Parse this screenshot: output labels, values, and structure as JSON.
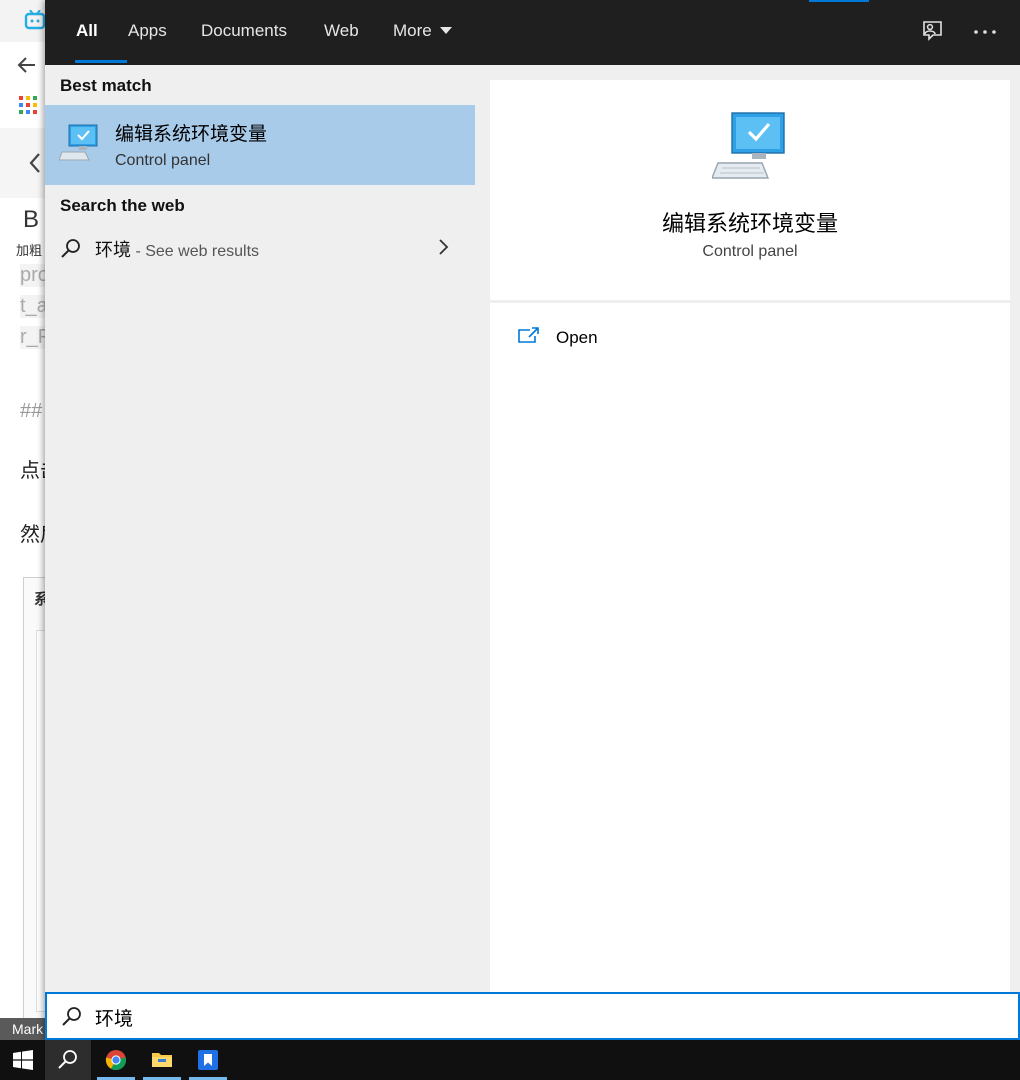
{
  "background_app": {
    "toolbar_letter": "B",
    "toolbar_caption": "加粗",
    "lines": [
      "pro",
      "t_a",
      "r_F",
      "##",
      "点击",
      "然后"
    ],
    "panel_label": "系",
    "status": "Mark"
  },
  "tabs": [
    {
      "label": "All",
      "active": true
    },
    {
      "label": "Apps"
    },
    {
      "label": "Documents"
    },
    {
      "label": "Web"
    },
    {
      "label": "More"
    }
  ],
  "toolbar_icons": [
    "feedback-icon",
    "more-options-icon"
  ],
  "best_match": {
    "heading": "Best match",
    "title": "编辑系统环境变量",
    "subtitle": "Control panel",
    "icon": "monitor-check-icon"
  },
  "web": {
    "heading": "Search the web",
    "query": "环境",
    "hint": " - See web results"
  },
  "preview": {
    "title": "编辑系统环境变量",
    "subtitle": "Control panel"
  },
  "actions": [
    {
      "label": "Open",
      "icon": "open-icon"
    }
  ],
  "search": {
    "value": "环境"
  },
  "taskbar": [
    "start-icon",
    "search-icon",
    "chrome-icon",
    "file-explorer-icon",
    "app-icon"
  ],
  "colors": {
    "accent": "#0078d7",
    "selected_row": "#a9cbea",
    "tabbar": "#1f1f1f",
    "taskbar": "#101010"
  }
}
